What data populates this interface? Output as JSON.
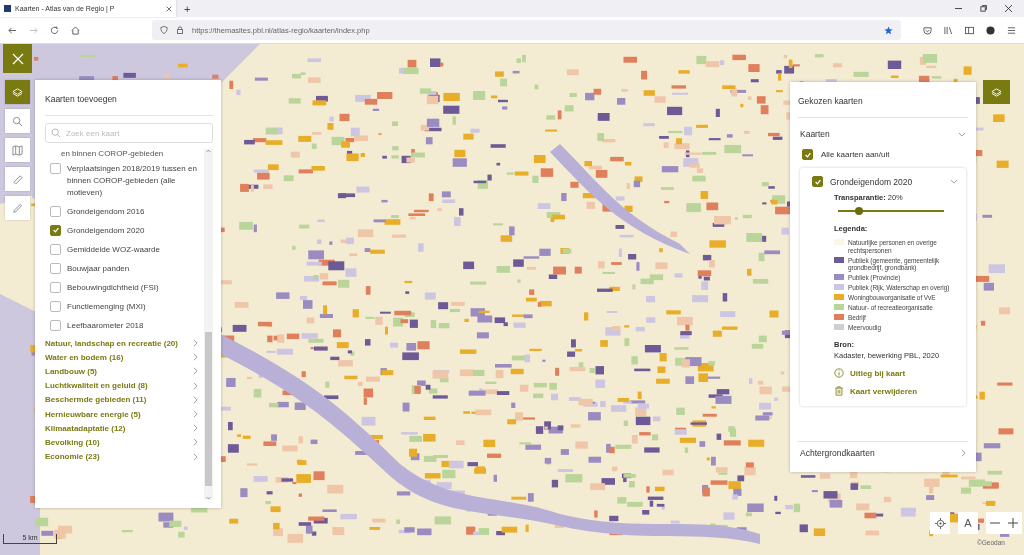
{
  "browser": {
    "tab_title": "Kaarten - Atlas van de Regio | P",
    "new_tab": "+",
    "url": "https://themasites.pbl.nl/atlas-regio/kaarten/index.php"
  },
  "tools": [
    {
      "kind": "layers",
      "selected": true
    },
    {
      "kind": "search",
      "selected": false
    },
    {
      "kind": "book",
      "selected": false
    },
    {
      "kind": "ruler",
      "selected": false
    },
    {
      "kind": "pencil",
      "selected": false
    }
  ],
  "add_panel": {
    "title": "Kaarten toevoegen",
    "search": {
      "placeholder": "Zoek een kaart"
    },
    "layers": [
      {
        "label": "en binnen COROP-gebieden",
        "kind": "cut"
      },
      {
        "label": "Verplaatsingen 2018/2019 tussen en binnen COROP-gebieden (alle motieven)",
        "kind": "item",
        "checked": false
      },
      {
        "label": "Grondeigendom 2016",
        "kind": "item",
        "checked": false
      },
      {
        "label": "Grondeigendom 2020",
        "kind": "item",
        "checked": true
      },
      {
        "label": "Gemiddelde WOZ-waarde",
        "kind": "item",
        "checked": false
      },
      {
        "label": "Bouwjaar panden",
        "kind": "item",
        "checked": false
      },
      {
        "label": "Bebouwingdichtheid (FSI)",
        "kind": "item",
        "checked": false
      },
      {
        "label": "Functiemenging (MXI)",
        "kind": "item",
        "checked": false
      },
      {
        "label": "Leefbaarometer 2018",
        "kind": "item",
        "checked": false
      }
    ],
    "categories": [
      "Natuur, landschap en recreatie (20)",
      "Water en bodem (16)",
      "Landbouw (5)",
      "Luchtkwaliteit en geluid (8)",
      "Beschermde gebieden (11)",
      "Hernieuwbare energie (5)",
      "Klimaatadaptatie (12)",
      "Bevolking (10)",
      "Economie (23)"
    ]
  },
  "chosen_panel": {
    "title": "Gekozen kaarten",
    "section": {
      "label": "Kaarten",
      "expanded": true
    },
    "all_toggle": {
      "label": "Alle kaarten aan/uit",
      "checked": true
    },
    "layer": {
      "name": "Grondeigendom 2020",
      "checked": true,
      "expanded": true,
      "transparency_label": "Transparantie:",
      "transparency_value": "20%",
      "level": 0.2,
      "legend_title": "Legenda:",
      "legend": [
        {
          "label": "Natuurlijke personen en overige rechtspersonen",
          "color": "#fbf6e6"
        },
        {
          "label": "Publiek (gemeente, gemeentelijk grondbedrijf, grondbank)",
          "color": "#6e5a96"
        },
        {
          "label": "Publiek (Provincie)",
          "color": "#9a8cc0"
        },
        {
          "label": "Publiek (Rijk, Waterschap en overig)",
          "color": "#cdc6e2"
        },
        {
          "label": "Woningbouworganisatie of VvE",
          "color": "#e8ae2a"
        },
        {
          "label": "Natuur- of recreatieorganisatie",
          "color": "#b9d59a"
        },
        {
          "label": "Bedrijf",
          "color": "#e07f5c"
        },
        {
          "label": "Meervoudig",
          "color": "#cfcfcf"
        }
      ],
      "source_title": "Bron:",
      "source": "Kadaster, bewerking PBL, 2020",
      "actions": [
        {
          "kind": "info",
          "label": "Uitleg bij kaart"
        },
        {
          "kind": "delete",
          "label": "Kaart verwijderen"
        }
      ]
    },
    "background_section": {
      "label": "Achtergrondkaarten"
    }
  },
  "map": {
    "scale": "5 km",
    "attribution": "©Geodan",
    "locate_label": "A"
  }
}
